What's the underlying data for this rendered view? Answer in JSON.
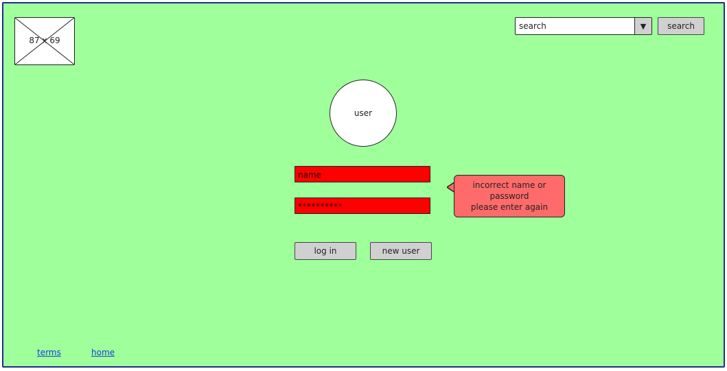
{
  "logo": {
    "label": "87 x 69",
    "icon": "image-placeholder-icon"
  },
  "search": {
    "select_value": "search",
    "dropdown_arrow": "▼",
    "button_label": "search"
  },
  "avatar": {
    "label": "user"
  },
  "login_form": {
    "name_value": "name",
    "password_value": "**********",
    "error_message_line1": "incorrect name or password",
    "error_message_line2": "please enter again",
    "login_label": "log in",
    "new_user_label": "new user"
  },
  "footer": {
    "terms_label": "terms",
    "home_label": "home"
  },
  "colors": {
    "background": "#9eff9b",
    "frame_border": "#1f2a8f",
    "field_error": "#ff0000",
    "tooltip": "#ff6a6a",
    "button": "#d0d0d0",
    "link": "#1a3bdb"
  }
}
